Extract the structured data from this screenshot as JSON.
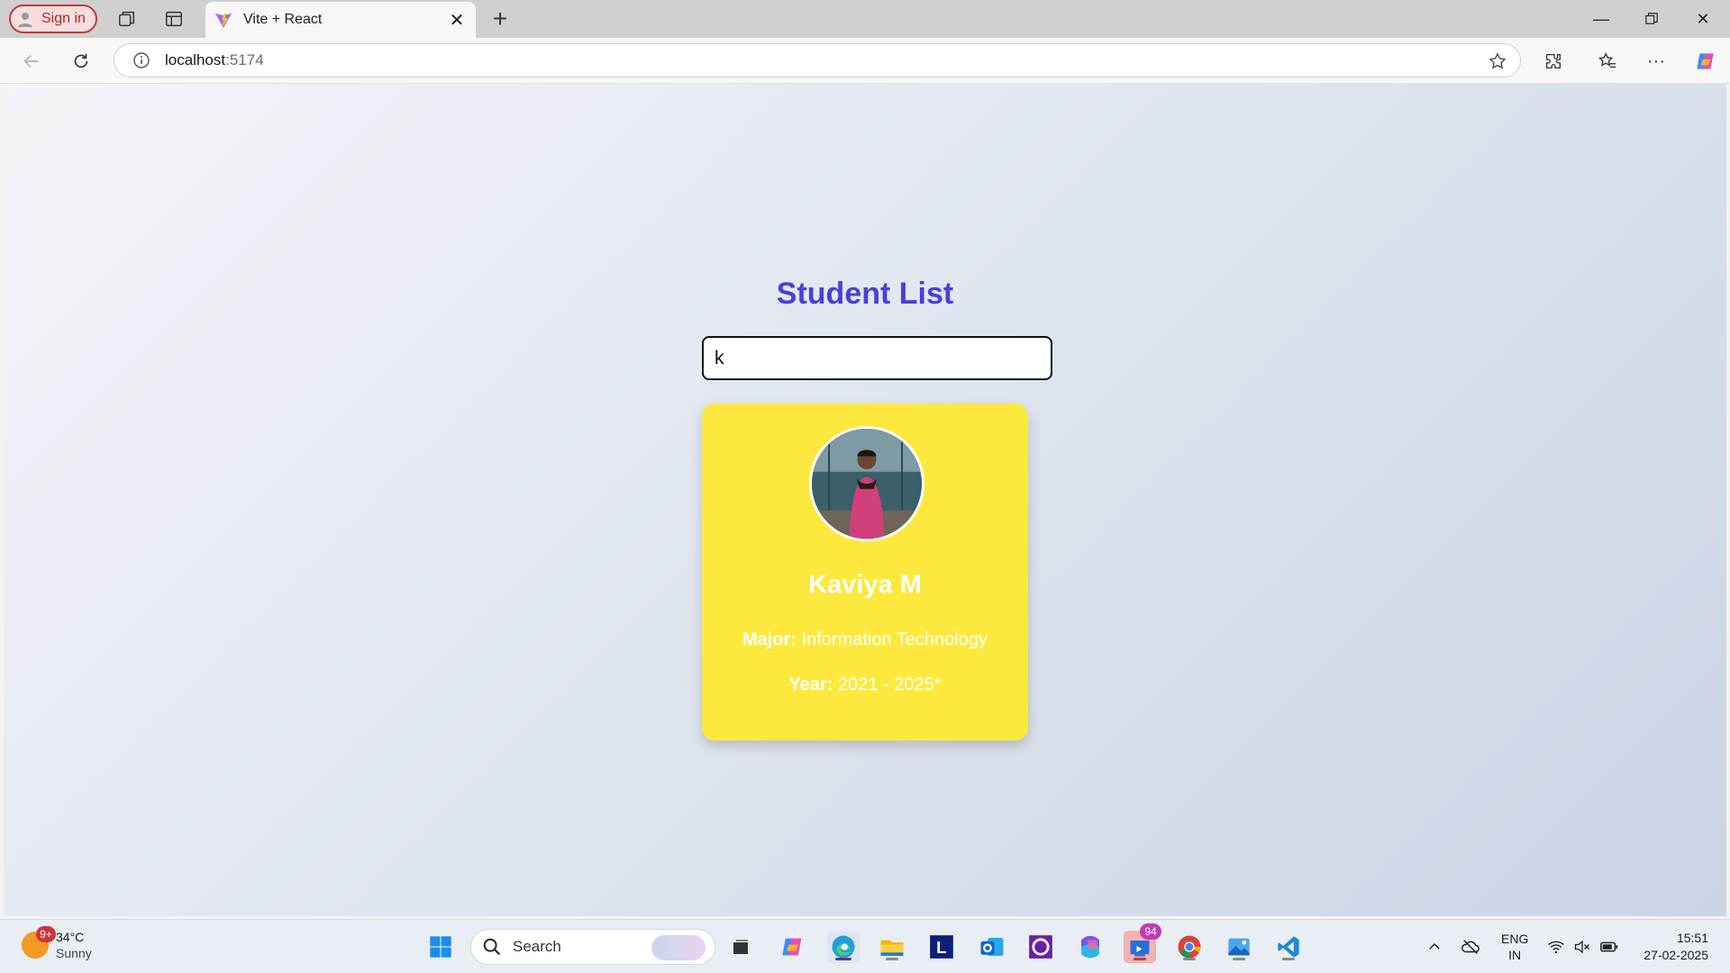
{
  "browser": {
    "sign_in_label": "Sign in",
    "tab_title": "Vite + React",
    "url_host": "localhost",
    "url_port": ":5174"
  },
  "page": {
    "title": "Student List",
    "search_value": "k",
    "students": [
      {
        "name": "Kaviya M",
        "major_label": "Major:",
        "major": "Information Technology",
        "year_label": "Year:",
        "year": "2021 - 2025*"
      }
    ]
  },
  "taskbar": {
    "weather_temp": "34°C",
    "weather_condition": "Sunny",
    "weather_badge": "9+",
    "search_label": "Search",
    "teams_badge": "94",
    "language_line1": "ENG",
    "language_line2": "IN",
    "time": "15:51",
    "date": "27-02-2025",
    "apps": [
      "start-icon",
      "task-view-icon",
      "copilot-icon",
      "edge-icon",
      "file-explorer-icon",
      "app-l-icon",
      "outlook-icon",
      "cortana-icon",
      "m365-icon",
      "teams-icon",
      "chrome-icon",
      "paint-icon",
      "vscode-icon"
    ]
  },
  "colors": {
    "title": "#4a3fdb",
    "card": "#fde93d",
    "card_text": "#ffffff"
  }
}
